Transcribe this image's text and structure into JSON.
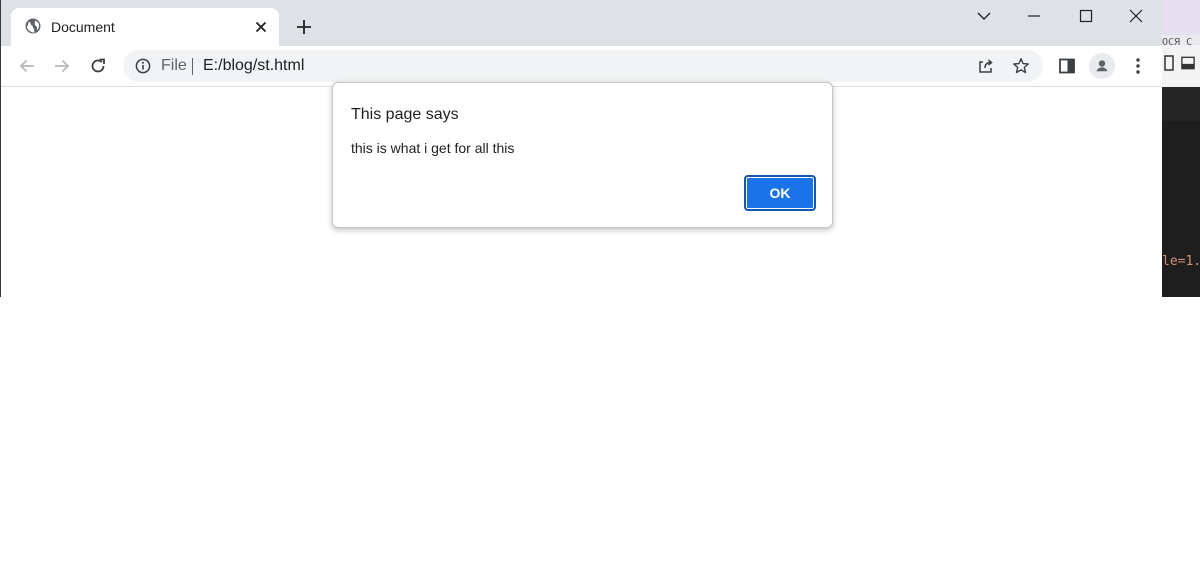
{
  "browser": {
    "tab": {
      "title": "Document"
    },
    "address": {
      "scheme_label": "File",
      "url": "E:/blog/st.html"
    }
  },
  "dialog": {
    "title": "This page says",
    "message": "this is what i get for all this",
    "ok_label": "OK"
  },
  "background_editor": {
    "partial_text": "ОСЯ С",
    "code_fragment": "le=1."
  },
  "colors": {
    "tabstrip": "#dee1e6",
    "accent": "#1a73e8",
    "omnibox": "#f1f3f4",
    "editor_bg": "#1e1e1e",
    "code_string": "#ce9178"
  },
  "icons": {
    "tab_favicon": "globe-icon",
    "tab_close": "close-icon",
    "new_tab": "plus-icon",
    "tab_search": "chevron-down-icon",
    "minimize": "minimize-icon",
    "maximize": "maximize-icon",
    "close_window": "close-icon",
    "back": "arrow-left-icon",
    "forward": "arrow-right-icon",
    "reload": "reload-icon",
    "site_info": "info-icon",
    "share": "share-icon",
    "bookmark": "star-icon",
    "side_panel": "side-panel-icon",
    "profile": "person-icon",
    "menu": "kebab-menu-icon"
  }
}
